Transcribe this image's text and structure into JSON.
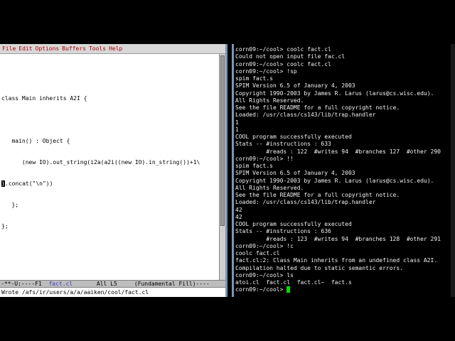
{
  "emacs": {
    "menu": [
      "File",
      "Edit",
      "Options",
      "Buffers",
      "Tools",
      "Help"
    ],
    "code_lines": [
      "",
      "class Main inherits A2I {",
      "",
      "   main() : Object {",
      "      (new IO).out_string(i2a(a2i((new IO).in_string())+1\\",
      "[CURSOR].concat(\"\\n\"))",
      "   };",
      "};"
    ],
    "cursor_char": ")",
    "cursor_rest": ".concat(\"\\n\"))",
    "modeline": "-**-U:----F1  fact.cl       All L5     (Fundamental Fill)----",
    "modeline_prefix": "-**-U:----F1  ",
    "modeline_buffer": "fact.cl",
    "modeline_suffix": "       All L5     (Fundamental Fill)----",
    "minibuffer": "Wrote /afs/ir/users/a/a/aaiken/cool/fact.cl"
  },
  "terminal": {
    "lines": [
      "corn09:~/cool> coolc fact.cl",
      "Could not open input file fac.cl",
      "corn09:~/cool> coolc fact.cl",
      "corn09:~/cool> !sp",
      "spim fact.s",
      "SPIM Version 6.5 of January 4, 2003",
      "Copyright 1990-2003 by James R. Larus (larus@cs.wisc.edu).",
      "All Rights Reserved.",
      "See the file README for a full copyright notice.",
      "Loaded: /usr/class/cs143/lib/trap.handler",
      "1",
      "1",
      "COOL program successfully executed",
      "Stats -- #instructions : 633",
      "         #reads : 122  #writes 94  #branches 127  #other 290",
      "corn09:~/cool> !!",
      "spim fact.s",
      "SPIM Version 6.5 of January 4, 2003",
      "Copyright 1990-2003 by James R. Larus (larus@cs.wisc.edu).",
      "All Rights Reserved.",
      "See the file README for a full copyright notice.",
      "Loaded: /usr/class/cs143/lib/trap.handler",
      "42",
      "42",
      "COOL program successfully executed",
      "Stats -- #instructions : 636",
      "         #reads : 123  #writes 94  #branches 128  #other 291",
      "corn09:~/cool> !c",
      "coolc fact.cl",
      "fact.cl:2: Class Main inherits from an undefined class A2I.",
      "Compilation halted due to static semantic errors.",
      "corn09:~/cool> ls",
      "atoi.cl  fact.cl  fact.cl~  fact.s"
    ],
    "prompt": "corn09:~/cool> "
  },
  "colors": {
    "emacs_menu_text": "#b00000",
    "modeline_buffer": "#3c3cc8",
    "terminal_text": "#f2f2f2",
    "terminal_cursor": "#00e000",
    "window_border": "#7a95b5"
  }
}
